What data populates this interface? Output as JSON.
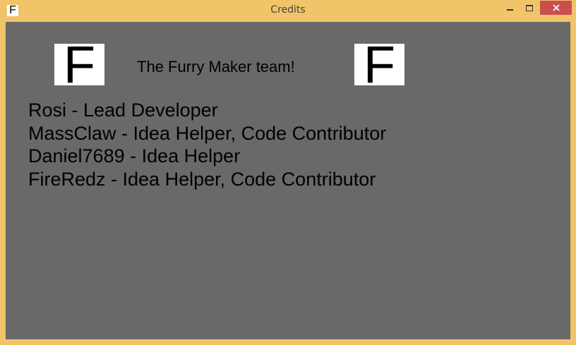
{
  "window": {
    "title": "Credits",
    "icon_letter": "F",
    "controls": [
      "minimize-icon",
      "maximize-icon",
      "close-icon"
    ]
  },
  "header": {
    "logo_letter": "F",
    "team_title": "The Furry Maker team!"
  },
  "credits": [
    "Rosi - Lead Developer",
    "MassClaw - Idea Helper, Code Contributor",
    "Daniel7689 - Idea Helper",
    "FireRedz - Idea Helper, Code Contributor"
  ],
  "colors": {
    "frame": "#f1c46a",
    "client_background": "#696969",
    "close_button": "#c94f4f"
  }
}
